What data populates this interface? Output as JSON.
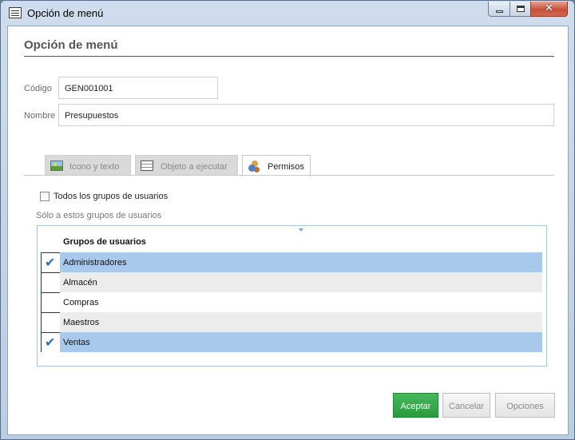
{
  "window": {
    "title": "Opción de menú"
  },
  "controls": {
    "close_glyph": "✕"
  },
  "form": {
    "heading": "Opción de menú",
    "codigo_label": "Código",
    "codigo_value": "GEN001001",
    "nombre_label": "Nombre",
    "nombre_value": "Presupuestos"
  },
  "tabs": [
    {
      "label": "Icono y texto",
      "icon": "image-icon",
      "active": false
    },
    {
      "label": "Objeto a ejecutar",
      "icon": "table-icon",
      "active": false
    },
    {
      "label": "Permisos",
      "icon": "users-icon",
      "active": true
    }
  ],
  "permisos": {
    "all_groups_label": "Todos los grupos de usuarios",
    "all_groups_checked": false,
    "only_groups_label": "Sólo a estos grupos de usuarios",
    "column_header": "Grupos de usuarios",
    "groups": [
      {
        "name": "Administradores",
        "checked": true
      },
      {
        "name": "Almacén",
        "checked": false
      },
      {
        "name": "Compras",
        "checked": false
      },
      {
        "name": "Maestros",
        "checked": false
      },
      {
        "name": "Ventas",
        "checked": true
      }
    ],
    "check_glyph": "✔"
  },
  "buttons": {
    "accept": "Aceptar",
    "cancel": "Cancelar",
    "options": "Opciones"
  },
  "colors": {
    "accent_green": "#2a9a3e",
    "selection_blue": "#a8c8ec"
  }
}
